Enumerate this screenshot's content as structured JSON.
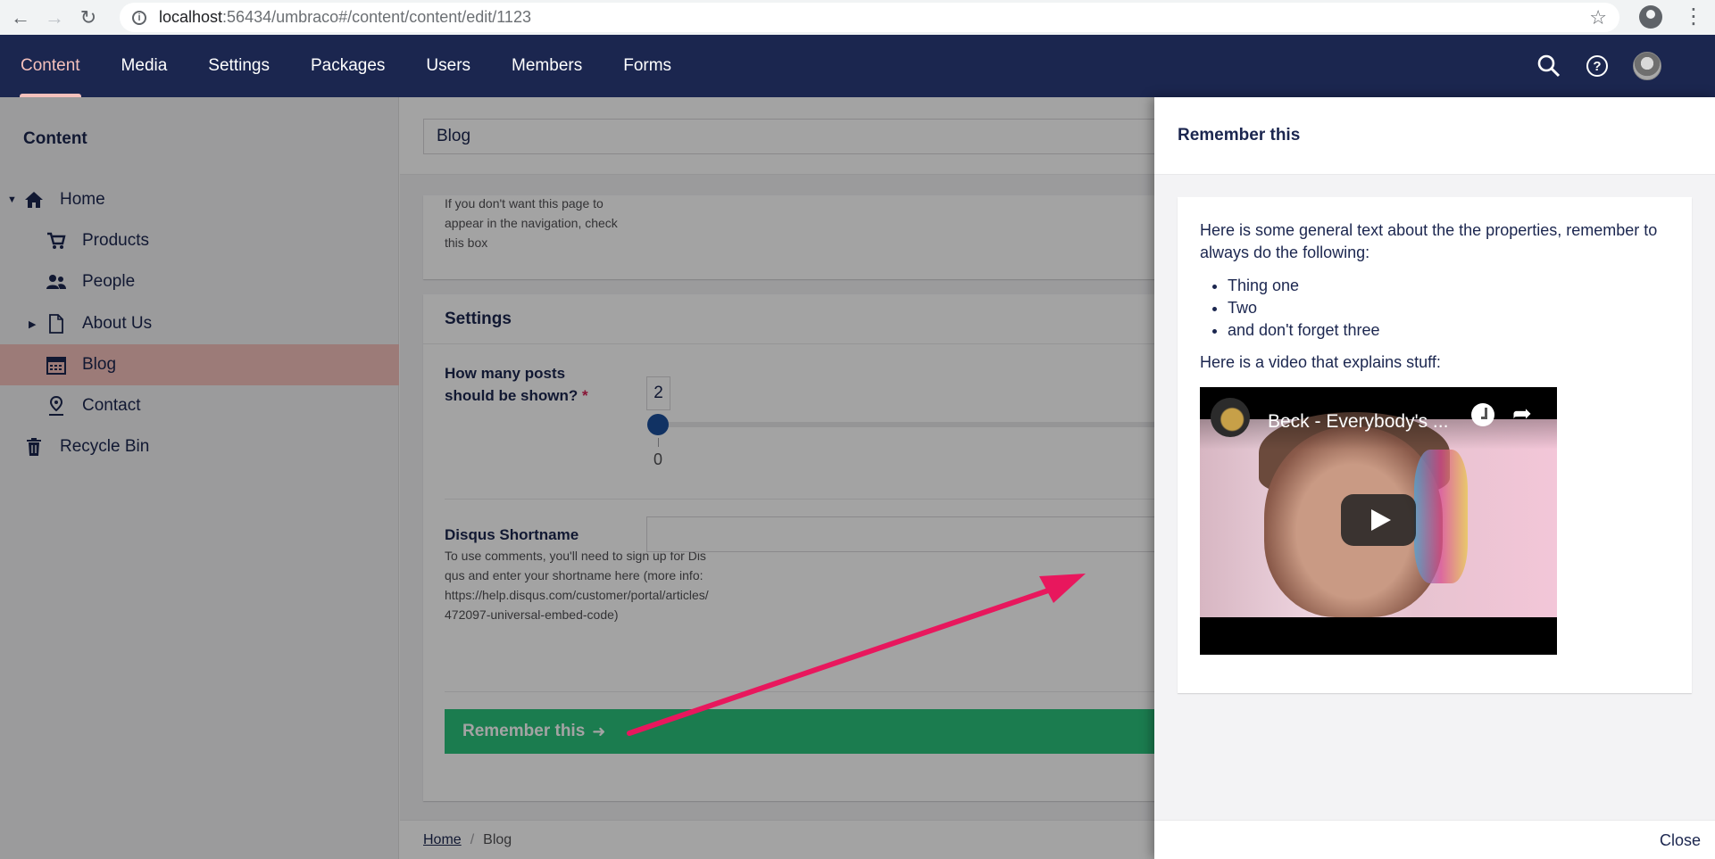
{
  "browser": {
    "url_host": "localhost",
    "url_rest": ":56434/umbraco#/content/content/edit/1123"
  },
  "header": {
    "sections": [
      "Content",
      "Media",
      "Settings",
      "Packages",
      "Users",
      "Members",
      "Forms"
    ],
    "active_section": "Content"
  },
  "sidebar": {
    "title": "Content",
    "items": [
      {
        "label": "Home",
        "icon": "home-icon"
      },
      {
        "label": "Products",
        "icon": "cart-icon"
      },
      {
        "label": "People",
        "icon": "users-icon"
      },
      {
        "label": "About Us",
        "icon": "document-icon"
      },
      {
        "label": "Blog",
        "icon": "calendar-icon"
      },
      {
        "label": "Contact",
        "icon": "map-pin-icon"
      },
      {
        "label": "Recycle Bin",
        "icon": "trash-icon"
      }
    ],
    "selected": "Blog"
  },
  "editor": {
    "node_name": "Blog",
    "hide_nav_desc": "If you don't want this page to appear in the navigation, check this box",
    "settings_group": "Settings",
    "posts_label": "How many posts should be shown?",
    "required_mark": "*",
    "posts_value": "2",
    "slider_min": "0",
    "disqus_label": "Disqus Shortname",
    "disqus_desc": "To use comments, you'll need to sign up for Disqus and enter your shortname here (more info: https://help.disqus.com/customer/portal/articles/472097-universal-embed-code)",
    "remember_button": "Remember this",
    "breadcrumb": [
      "Home",
      "Blog"
    ]
  },
  "drawer": {
    "title": "Remember this",
    "intro": "Here is some general text about the the properties, remember to always do the following:",
    "list": [
      "Thing one",
      "Two",
      "and don't forget three"
    ],
    "video_caption": "Here is a video that explains stuff:",
    "video_title": "Beck - Everybody's ...",
    "close_label": "Close"
  },
  "colors": {
    "header_bg": "#1b264f",
    "active_accent": "#f5c1bc",
    "button_green": "#2bc37c",
    "arrow_pink": "#e8175d"
  }
}
